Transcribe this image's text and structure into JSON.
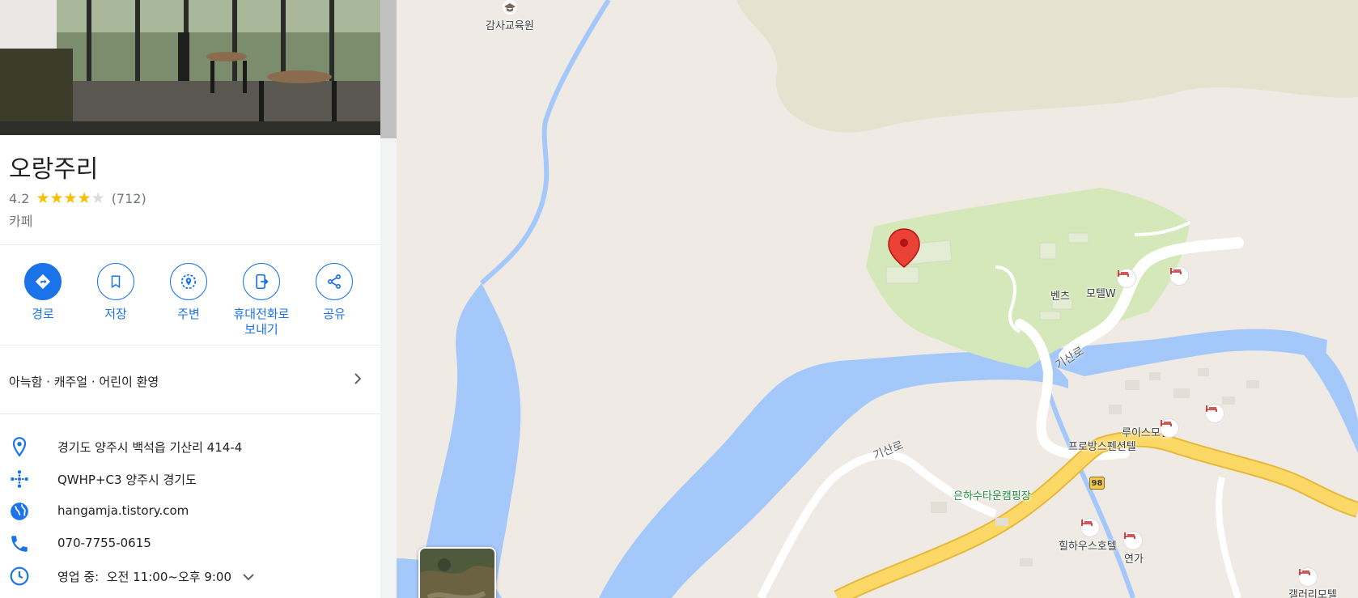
{
  "place": {
    "name": "오랑주리",
    "rating": "4.2",
    "stars_filled": 4,
    "stars_total": 5,
    "review_count": "(712)",
    "category": "카페"
  },
  "actions": [
    {
      "label": "경로",
      "icon": "directions-icon"
    },
    {
      "label": "저장",
      "icon": "bookmark-icon"
    },
    {
      "label": "주변",
      "icon": "nearby-icon"
    },
    {
      "label_line1": "휴대전화로",
      "label_line2": "보내기",
      "icon": "send-to-phone-icon"
    },
    {
      "label": "공유",
      "icon": "share-icon"
    }
  ],
  "tags": "아늑함 · 캐주얼 · 어린이 환영",
  "info": {
    "address": "경기도 양주시 백석읍 기산리 414-4",
    "plus_code": "QWHP+C3 양주시 경기도",
    "website": "hangamja.tistory.com",
    "phone": "070-7755-0615",
    "hours_status": "영업 중:",
    "hours": "오전 11:00~오후 9:00"
  },
  "map": {
    "labels": {
      "education": "감사교육원",
      "bents": "벤츠",
      "motel_w": "모텔W",
      "road_gisan_1": "기산로",
      "road_gisan_2": "기산로",
      "louis_motel": "루이스모텔",
      "provence_pension": "프로방스펜션텔",
      "camping": "은하수타운캠핑장",
      "hill_house": "힐하우스호텔",
      "yeonga": "연가",
      "gallery_motel": "갤러리모텔",
      "route_number": "98"
    },
    "colors": {
      "land": "#efebe4",
      "water": "#a5c8fb",
      "park": "#d5e8b9",
      "highway": "#fcd967",
      "pin": "#ea4335"
    }
  }
}
